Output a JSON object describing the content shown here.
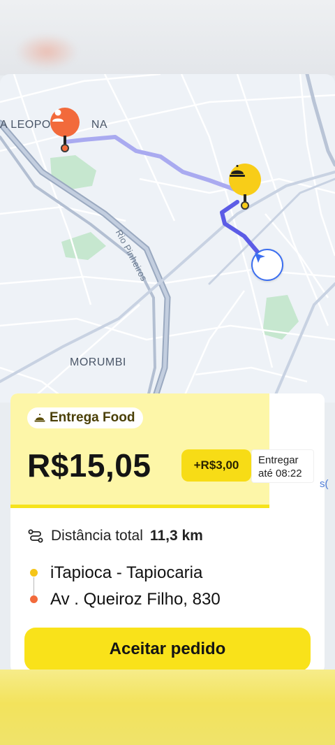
{
  "map": {
    "label_neighborhood_1": "A LEOPO",
    "label_neighborhood_1_tail": "NA",
    "label_neighborhood_2": "MORUMBI",
    "label_river": "Rio Pinheiros"
  },
  "order": {
    "category": "Entrega Food",
    "price": "R$15,05",
    "bonus": "+R$3,00",
    "deadline_label": "Entregar",
    "deadline_time": "até 08:22",
    "distance_label": "Distância total",
    "distance_value": "11,3 km",
    "pickup": "iTapioca - Tapiocaria",
    "dropoff": "Av . Queiroz Filho, 830",
    "accept_label": "Aceitar pedido"
  },
  "edge_fragment": "s(",
  "colors": {
    "brand_yellow": "#f9e21a",
    "pickup_dot": "#f5c518",
    "dropoff_dot": "#f26a3b",
    "route": "#5c5ce6"
  }
}
